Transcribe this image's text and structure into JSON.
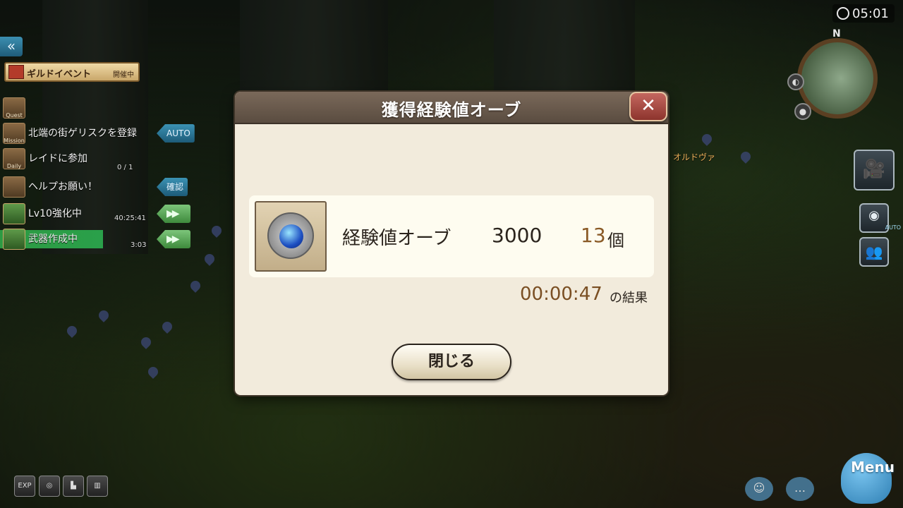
{
  "hud": {
    "clock": "05:01",
    "north": "N",
    "actor_label": "オルドヴァ",
    "guild_event": {
      "title": "ギルドイベント",
      "status": "開催中"
    },
    "quests": [
      {
        "icon_label": "Quest",
        "text": "",
        "time": "",
        "tag": ""
      },
      {
        "icon_label": "Mission",
        "text": "北端の街ゲリスクを登録",
        "time": "",
        "tag": "AUTO"
      },
      {
        "icon_label": "Daily",
        "text": "レイドに参加",
        "time": "0 / 1",
        "tag": ""
      },
      {
        "icon_label": "",
        "text": "ヘルプお願い！",
        "time": "",
        "tag": "確認"
      },
      {
        "icon_label": "",
        "text": "Lv10強化中",
        "time": "40:25:41",
        "tag": "▶▶"
      },
      {
        "icon_label": "",
        "text": "武器作成中",
        "time": "3:03",
        "tag": "▶▶"
      }
    ],
    "right_buttons": {
      "auto_label": "AUTO"
    },
    "bottom": {
      "exp_label": "EXP",
      "menu_label": "Menu"
    }
  },
  "dialog": {
    "title": "獲得経験値オーブ",
    "close_icon": "close-icon",
    "item": {
      "name": "経験値オーブ",
      "value": "3000",
      "count": "13",
      "unit": "個"
    },
    "elapsed": "00:00:47",
    "elapsed_suffix": "の結果",
    "ok_label": "閉じる"
  }
}
